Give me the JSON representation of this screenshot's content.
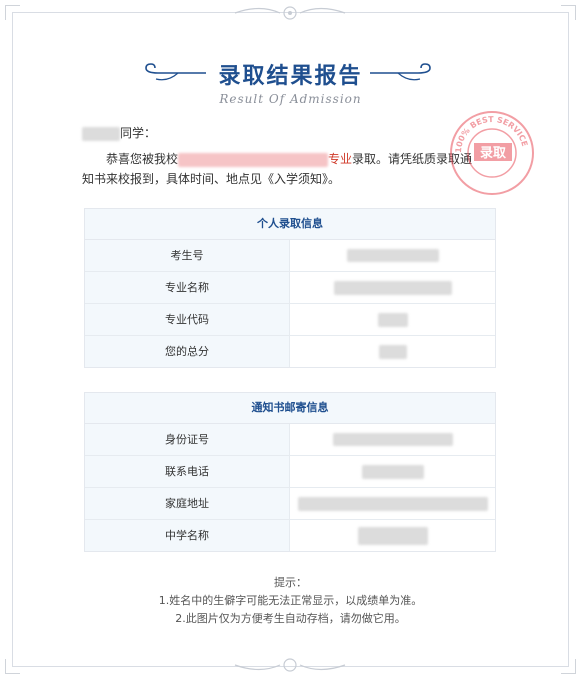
{
  "header": {
    "title": "录取结果报告",
    "subtitle": "Result Of Admission"
  },
  "letter": {
    "salutation_suffix": "同学：",
    "line_prefix": "恭喜您被我校",
    "major_word": "专业",
    "line_suffix": "录取。请凭纸质录取通",
    "line2": "知书来校报到，具体时间、地点见《入学须知》。"
  },
  "stamp": {
    "ring_text": "100% BEST SERVICE",
    "center_text": "录取",
    "color": "#e8505b"
  },
  "personal_info": {
    "heading": "个人录取信息",
    "rows": [
      {
        "label": "考生号"
      },
      {
        "label": "专业名称"
      },
      {
        "label": "专业代码"
      },
      {
        "label": "您的总分"
      }
    ]
  },
  "mailing_info": {
    "heading": "通知书邮寄信息",
    "rows": [
      {
        "label": "身份证号"
      },
      {
        "label": "联系电话"
      },
      {
        "label": "家庭地址"
      },
      {
        "label": "中学名称"
      }
    ]
  },
  "tips": {
    "title": "提示：",
    "items": [
      "1.姓名中的生僻字可能无法正常显示，以成绩单为准。",
      "2.此图片仅为方便考生自动存档，请勿做它用。"
    ]
  },
  "colors": {
    "accent": "#1f4f8f",
    "highlight": "#d03a2a",
    "panel_label_bg": "#f3f8fc"
  }
}
